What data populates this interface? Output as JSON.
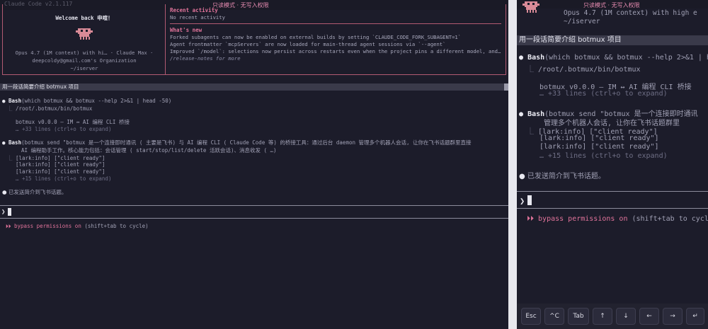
{
  "left": {
    "ghost_title": "Claude Code v2.1.117",
    "mode_banner": "只读模式 · 无写入权限",
    "welcome": {
      "title": "Welcome back 申喧！",
      "model_line": "Opus 4.7 (1M context) with hi… · Claude Max ·",
      "org_line": "deepcoldy@gmail.com's Organization",
      "cwd": "~/iserver"
    },
    "recent": {
      "heading": "Recent activity",
      "empty": "No recent activity",
      "whats_new_heading": "What's new",
      "items": [
        "Forked subagents can now be enabled on external builds by setting `CLAUDE_CODE_FORK_SUBAGENT=1`",
        "Agent frontmatter `mcpServers` are now loaded for main-thread agent sessions via `--agent`",
        "Improved `/model`: selections now persist across restarts even when the project pins a different model, and…"
      ],
      "release_notes": "/release-notes for more"
    },
    "prompt_title": "用一段话简要介绍 botmux 项目",
    "bash1": {
      "tool": "Bash",
      "args": "(which botmux && botmux --help 2>&1 | head -50)",
      "path": "/root/.botmux/bin/botmux",
      "version": "botmux v0.0.0 — IM ↔ AI 编程 CLI 桥接",
      "more": "… +33 lines (ctrl+o to expand)"
    },
    "bash2": {
      "tool": "Bash",
      "args": "(botmux send \"botmux 是一个连接即时通讯 ( 主要是飞书) 与 AI 编程 CLI ( Claude Code 等) 的桥接工具：通过后台 daemon 管理多个机器人会话, 让你在飞书话题群里直接",
      "args2": "AI 编程助手工作。核心能力包括：会话管理 ( start/stop/list/delete 活跃会话)、消息收发 ( …)",
      "out": [
        "[lark:info] [\"client ready\"]",
        "[lark:info] [\"client ready\"]",
        "[lark:info] [\"client ready\"]"
      ],
      "more": "… +15 lines (ctrl+o to expand)"
    },
    "done": "已发送简介到飞书话题。",
    "prompt_symbol": "❯",
    "perm_icon": "⏵⏵",
    "perm_text": "bypass permissions on",
    "perm_hint": "(shift+tab to cycle)"
  },
  "right": {
    "mode_banner": "只读模式 · 无写入权限",
    "model_line": "Opus 4.7 (1M context) with high e",
    "cwd": "~/iserver",
    "prompt_title": "用一段话简要介绍 botmux 项目",
    "bash1": {
      "tool": "Bash",
      "args": "(which botmux && botmux --help 2>&1 | h",
      "path": "/root/.botmux/bin/botmux",
      "version": "botmux v0.0.0 — IM ↔ AI 编程 CLI 桥接",
      "more": "… +33 lines (ctrl+o to expand)"
    },
    "bash2": {
      "tool": "Bash",
      "args": "(botmux send \"botmux 是一个连接即时通讯",
      "args2": "管理多个机器人会话, 让你在飞书话题群里",
      "out": [
        "[lark:info] [\"client ready\"]",
        "[lark:info] [\"client ready\"]",
        "[lark:info] [\"client ready\"]"
      ],
      "more": "… +15 lines (ctrl+o to expand)"
    },
    "done": "已发送简介到飞书话题。",
    "prompt_symbol": "❯",
    "perm_icon": "⏵⏵",
    "perm_text": "bypass permissions on",
    "perm_hint": "(shift+tab to cycl",
    "keys": [
      "Esc",
      "^C",
      "Tab",
      "↑",
      "↓",
      "←",
      "→",
      "↵"
    ]
  },
  "colors": {
    "accent": "#e0739a",
    "border": "#b25a72",
    "bg": "#1c1c2a"
  }
}
